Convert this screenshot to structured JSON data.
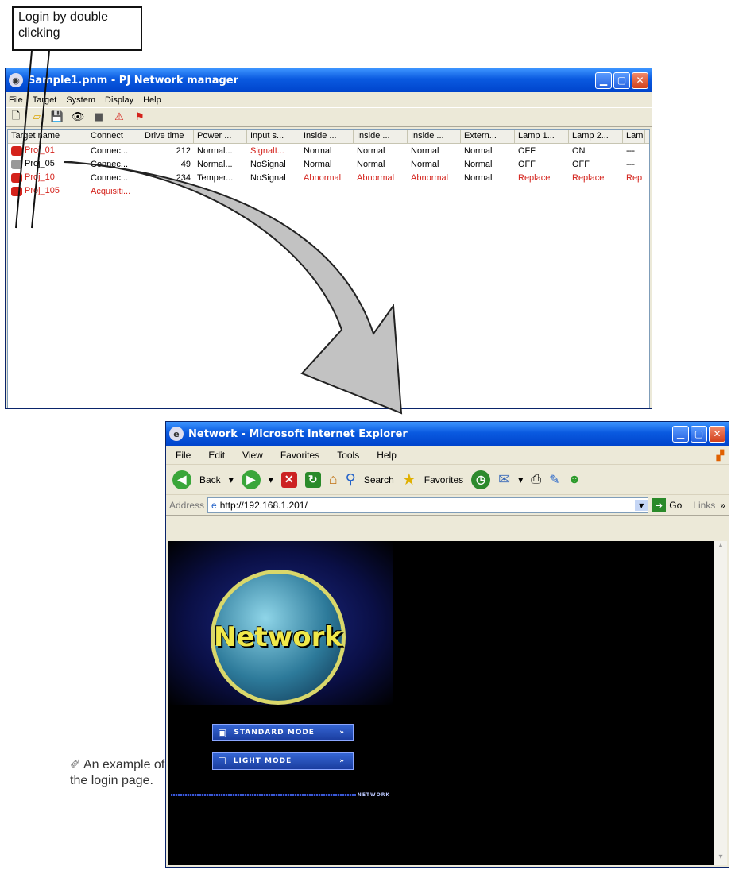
{
  "callout": {
    "text_line1": "Login by double",
    "text_line2": "clicking"
  },
  "pnm": {
    "title": "Sample1.pnm - PJ Network manager",
    "menu": [
      "File",
      "Target",
      "System",
      "Display",
      "Help"
    ],
    "columns": [
      "Target name",
      "Connect",
      "Drive time",
      "Power ...",
      "Input s...",
      "Inside ...",
      "Inside ...",
      "Inside ...",
      "Extern...",
      "Lamp 1...",
      "Lamp 2...",
      "Lam"
    ],
    "rows": [
      {
        "name": "Proj_01",
        "connect": "Connec...",
        "drive": "212",
        "power": "Normal...",
        "input": "SignalI...",
        "in1": "Normal",
        "in2": "Normal",
        "in3": "Normal",
        "ext": "Normal",
        "lamp1": "OFF",
        "lamp2": "ON",
        "lamp3": "---"
      },
      {
        "name": "Proj_05",
        "connect": "Connec...",
        "drive": "49",
        "power": "Normal...",
        "input": "NoSignal",
        "in1": "Normal",
        "in2": "Normal",
        "in3": "Normal",
        "ext": "Normal",
        "lamp1": "OFF",
        "lamp2": "OFF",
        "lamp3": "---"
      },
      {
        "name": "Proj_10",
        "connect": "Connec...",
        "drive": "234",
        "power": "Temper...",
        "input": "NoSignal",
        "in1": "Abnormal",
        "in2": "Abnormal",
        "in3": "Abnormal",
        "ext": "Normal",
        "lamp1": "Replace",
        "lamp2": "Replace",
        "lamp3": "Rep"
      },
      {
        "name": "Proj_105",
        "connect": "Acquisiti...",
        "drive": "",
        "power": "",
        "input": "",
        "in1": "",
        "in2": "",
        "in3": "",
        "ext": "",
        "lamp1": "",
        "lamp2": "",
        "lamp3": ""
      }
    ]
  },
  "ie": {
    "title": "Network - Microsoft Internet Explorer",
    "menu": [
      "File",
      "Edit",
      "View",
      "Favorites",
      "Tools",
      "Help"
    ],
    "back_label": "Back",
    "search_label": "Search",
    "favorites_label": "Favorites",
    "address_label": "Address",
    "url": "http://192.168.1.201/",
    "go_label": "Go",
    "links_label": "Links",
    "logo_text": "Network",
    "standard_mode": "STANDARD MODE",
    "light_mode": "LIGHT MODE",
    "network_tag": "NETWORK"
  },
  "note": "An example of the login page.",
  "colors": {
    "red": "#d4221b",
    "xp_blue": "#0a5ae0"
  }
}
